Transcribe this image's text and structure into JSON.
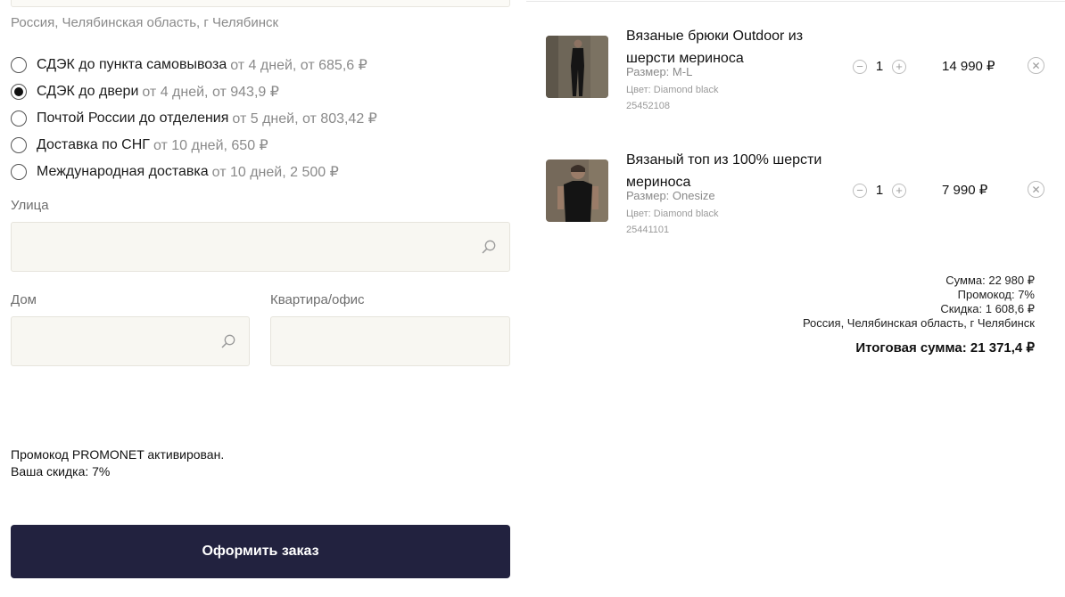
{
  "delivery": {
    "location": "Россия, Челябинская область, г Челябинск",
    "options": [
      {
        "title": "СДЭК до пункта самовывоза",
        "meta": "от 4 дней, от 685,6 ₽",
        "selected": false
      },
      {
        "title": "СДЭК до двери",
        "meta": "от 4 дней, от 943,9 ₽",
        "selected": true
      },
      {
        "title": "Почтой России до отделения",
        "meta": "от 5 дней, от 803,42 ₽",
        "selected": false
      },
      {
        "title": "Доставка по СНГ",
        "meta": "от 10 дней, 650 ₽",
        "selected": false
      },
      {
        "title": "Международная доставка",
        "meta": "от 10 дней, 2 500 ₽",
        "selected": false
      }
    ]
  },
  "address": {
    "street_label": "Улица",
    "street_value": "",
    "house_label": "Дом",
    "house_value": "",
    "apartment_label": "Квартира/офис",
    "apartment_value": ""
  },
  "promo": {
    "line1": "Промокод PROMONET активирован.",
    "line2": "Ваша скидка: 7%"
  },
  "submit_label": "Оформить заказ",
  "cart": {
    "items": [
      {
        "name": "Вязаные брюки Outdoor из шерсти мериноса",
        "size": "Размер: M-L",
        "color": "Цвет: Diamond black",
        "sku": "25452108",
        "quantity": "1",
        "price": "14 990 ₽"
      },
      {
        "name": "Вязаный топ из 100% шерсти мериноса",
        "size": "Размер: Onesize",
        "color": "Цвет: Diamond black",
        "sku": "25441101",
        "quantity": "1",
        "price": "7 990 ₽"
      }
    ]
  },
  "summary": {
    "sum": "Сумма: 22 980 ₽",
    "promocode": "Промокод: 7%",
    "discount": "Скидка: 1 608,6 ₽",
    "location": "Россия, Челябинская область, г Челябинск",
    "total": "Итоговая сумма: 21 371,4 ₽"
  },
  "icons": {
    "search": "search-icon",
    "minus": "minus-icon",
    "plus": "plus-icon",
    "remove": "close-icon"
  },
  "colors": {
    "button_bg": "#22223f",
    "field_bg": "#f8f7f2",
    "muted_text": "#8a8a8a"
  }
}
